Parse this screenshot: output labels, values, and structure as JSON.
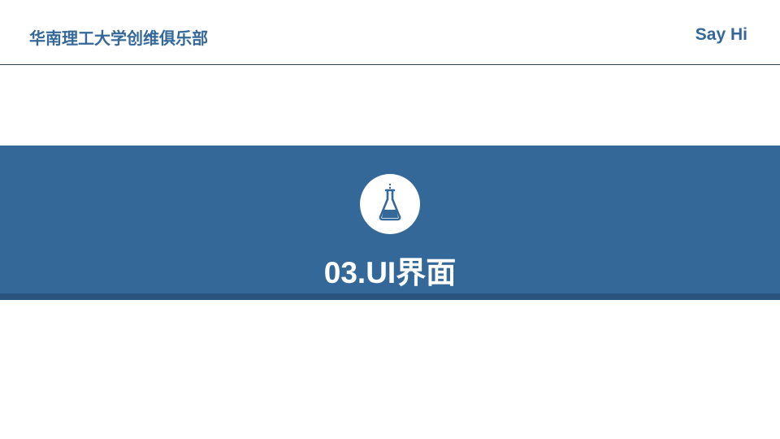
{
  "header": {
    "org_name": "华南理工大学创维俱乐部",
    "say_hi": "Say Hi"
  },
  "banner": {
    "icon": "flask-icon",
    "title": "03.UI界面"
  },
  "colors": {
    "primary_blue": "#346899",
    "banner_shadow": "#2b5380",
    "header_rule": "#2f3e4d",
    "background": "#ffffff"
  }
}
